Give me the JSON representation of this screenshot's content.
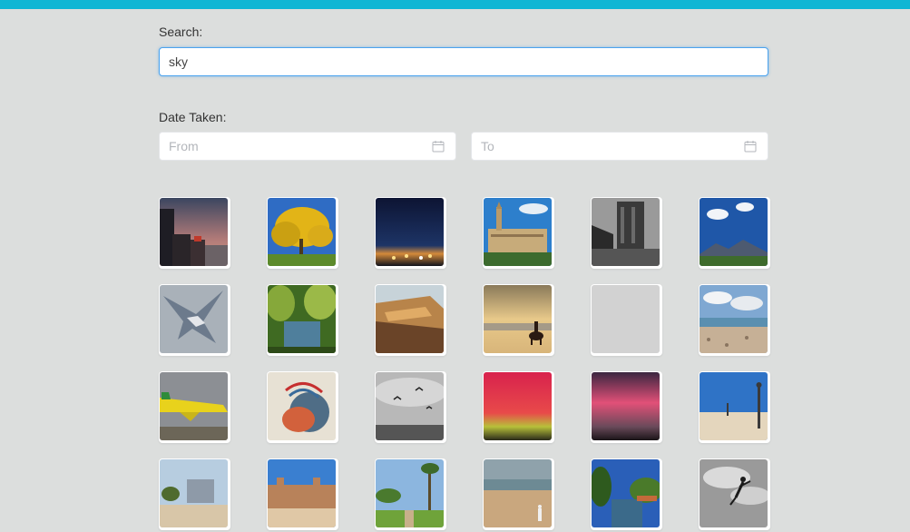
{
  "search": {
    "label": "Search:",
    "value": "sky"
  },
  "date_taken": {
    "label": "Date Taken:",
    "from_placeholder": "From",
    "to_placeholder": "To",
    "icon": "calendar-icon"
  },
  "photos": [
    {
      "subject": "city-dusk"
    },
    {
      "subject": "yellow-tree"
    },
    {
      "subject": "night-city-lights"
    },
    {
      "subject": "palace-blue-sky"
    },
    {
      "subject": "cathedral-bw"
    },
    {
      "subject": "mountains-clouds"
    },
    {
      "subject": "falcon-flying"
    },
    {
      "subject": "river-trees"
    },
    {
      "subject": "cliff-sunset"
    },
    {
      "subject": "horse-rider-beach"
    },
    {
      "subject": "placeholder-gray"
    },
    {
      "subject": "pebble-beach-clouds"
    },
    {
      "subject": "yellow-airplane"
    },
    {
      "subject": "bird-mural"
    },
    {
      "subject": "birds-flying-bw"
    },
    {
      "subject": "aurora-red-green"
    },
    {
      "subject": "aurora-pink"
    },
    {
      "subject": "beach-lamp-post"
    },
    {
      "subject": "plaza-building"
    },
    {
      "subject": "old-wall-street"
    },
    {
      "subject": "palm-park"
    },
    {
      "subject": "beach-person"
    },
    {
      "subject": "canal-trees"
    },
    {
      "subject": "person-jumping-bw"
    }
  ],
  "colors": {
    "accent_bar": "#0fb6d4",
    "background": "#dcdedd",
    "input_focus_border": "#4ba3ee"
  }
}
